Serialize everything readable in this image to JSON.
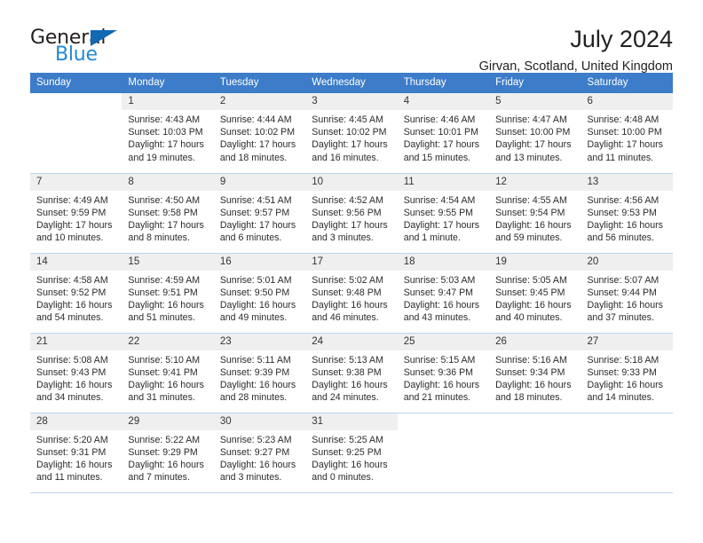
{
  "brand": {
    "name_part1": "General",
    "name_part2": "Blue",
    "triangle_color": "#1268b3",
    "blue_color": "#2389d4"
  },
  "header": {
    "title": "July 2024",
    "subtitle": "Girvan, Scotland, United Kingdom"
  },
  "theme": {
    "header_row_bg": "#3d7cc9",
    "header_row_text": "#ffffff",
    "daynum_bg": "#efefef",
    "cell_border": "#bcd3ec",
    "body_text": "#2b2b2b"
  },
  "calendar": {
    "weekday_headers": [
      "Sunday",
      "Monday",
      "Tuesday",
      "Wednesday",
      "Thursday",
      "Friday",
      "Saturday"
    ],
    "weeks": [
      [
        {
          "day": "",
          "blank": true,
          "lines": []
        },
        {
          "day": "1",
          "lines": [
            "Sunrise: 4:43 AM",
            "Sunset: 10:03 PM",
            "Daylight: 17 hours",
            "and 19 minutes."
          ]
        },
        {
          "day": "2",
          "lines": [
            "Sunrise: 4:44 AM",
            "Sunset: 10:02 PM",
            "Daylight: 17 hours",
            "and 18 minutes."
          ]
        },
        {
          "day": "3",
          "lines": [
            "Sunrise: 4:45 AM",
            "Sunset: 10:02 PM",
            "Daylight: 17 hours",
            "and 16 minutes."
          ]
        },
        {
          "day": "4",
          "lines": [
            "Sunrise: 4:46 AM",
            "Sunset: 10:01 PM",
            "Daylight: 17 hours",
            "and 15 minutes."
          ]
        },
        {
          "day": "5",
          "lines": [
            "Sunrise: 4:47 AM",
            "Sunset: 10:00 PM",
            "Daylight: 17 hours",
            "and 13 minutes."
          ]
        },
        {
          "day": "6",
          "lines": [
            "Sunrise: 4:48 AM",
            "Sunset: 10:00 PM",
            "Daylight: 17 hours",
            "and 11 minutes."
          ]
        }
      ],
      [
        {
          "day": "7",
          "lines": [
            "Sunrise: 4:49 AM",
            "Sunset: 9:59 PM",
            "Daylight: 17 hours",
            "and 10 minutes."
          ]
        },
        {
          "day": "8",
          "lines": [
            "Sunrise: 4:50 AM",
            "Sunset: 9:58 PM",
            "Daylight: 17 hours",
            "and 8 minutes."
          ]
        },
        {
          "day": "9",
          "lines": [
            "Sunrise: 4:51 AM",
            "Sunset: 9:57 PM",
            "Daylight: 17 hours",
            "and 6 minutes."
          ]
        },
        {
          "day": "10",
          "lines": [
            "Sunrise: 4:52 AM",
            "Sunset: 9:56 PM",
            "Daylight: 17 hours",
            "and 3 minutes."
          ]
        },
        {
          "day": "11",
          "lines": [
            "Sunrise: 4:54 AM",
            "Sunset: 9:55 PM",
            "Daylight: 17 hours",
            "and 1 minute."
          ]
        },
        {
          "day": "12",
          "lines": [
            "Sunrise: 4:55 AM",
            "Sunset: 9:54 PM",
            "Daylight: 16 hours",
            "and 59 minutes."
          ]
        },
        {
          "day": "13",
          "lines": [
            "Sunrise: 4:56 AM",
            "Sunset: 9:53 PM",
            "Daylight: 16 hours",
            "and 56 minutes."
          ]
        }
      ],
      [
        {
          "day": "14",
          "lines": [
            "Sunrise: 4:58 AM",
            "Sunset: 9:52 PM",
            "Daylight: 16 hours",
            "and 54 minutes."
          ]
        },
        {
          "day": "15",
          "lines": [
            "Sunrise: 4:59 AM",
            "Sunset: 9:51 PM",
            "Daylight: 16 hours",
            "and 51 minutes."
          ]
        },
        {
          "day": "16",
          "lines": [
            "Sunrise: 5:01 AM",
            "Sunset: 9:50 PM",
            "Daylight: 16 hours",
            "and 49 minutes."
          ]
        },
        {
          "day": "17",
          "lines": [
            "Sunrise: 5:02 AM",
            "Sunset: 9:48 PM",
            "Daylight: 16 hours",
            "and 46 minutes."
          ]
        },
        {
          "day": "18",
          "lines": [
            "Sunrise: 5:03 AM",
            "Sunset: 9:47 PM",
            "Daylight: 16 hours",
            "and 43 minutes."
          ]
        },
        {
          "day": "19",
          "lines": [
            "Sunrise: 5:05 AM",
            "Sunset: 9:45 PM",
            "Daylight: 16 hours",
            "and 40 minutes."
          ]
        },
        {
          "day": "20",
          "lines": [
            "Sunrise: 5:07 AM",
            "Sunset: 9:44 PM",
            "Daylight: 16 hours",
            "and 37 minutes."
          ]
        }
      ],
      [
        {
          "day": "21",
          "lines": [
            "Sunrise: 5:08 AM",
            "Sunset: 9:43 PM",
            "Daylight: 16 hours",
            "and 34 minutes."
          ]
        },
        {
          "day": "22",
          "lines": [
            "Sunrise: 5:10 AM",
            "Sunset: 9:41 PM",
            "Daylight: 16 hours",
            "and 31 minutes."
          ]
        },
        {
          "day": "23",
          "lines": [
            "Sunrise: 5:11 AM",
            "Sunset: 9:39 PM",
            "Daylight: 16 hours",
            "and 28 minutes."
          ]
        },
        {
          "day": "24",
          "lines": [
            "Sunrise: 5:13 AM",
            "Sunset: 9:38 PM",
            "Daylight: 16 hours",
            "and 24 minutes."
          ]
        },
        {
          "day": "25",
          "lines": [
            "Sunrise: 5:15 AM",
            "Sunset: 9:36 PM",
            "Daylight: 16 hours",
            "and 21 minutes."
          ]
        },
        {
          "day": "26",
          "lines": [
            "Sunrise: 5:16 AM",
            "Sunset: 9:34 PM",
            "Daylight: 16 hours",
            "and 18 minutes."
          ]
        },
        {
          "day": "27",
          "lines": [
            "Sunrise: 5:18 AM",
            "Sunset: 9:33 PM",
            "Daylight: 16 hours",
            "and 14 minutes."
          ]
        }
      ],
      [
        {
          "day": "28",
          "lines": [
            "Sunrise: 5:20 AM",
            "Sunset: 9:31 PM",
            "Daylight: 16 hours",
            "and 11 minutes."
          ]
        },
        {
          "day": "29",
          "lines": [
            "Sunrise: 5:22 AM",
            "Sunset: 9:29 PM",
            "Daylight: 16 hours",
            "and 7 minutes."
          ]
        },
        {
          "day": "30",
          "lines": [
            "Sunrise: 5:23 AM",
            "Sunset: 9:27 PM",
            "Daylight: 16 hours",
            "and 3 minutes."
          ]
        },
        {
          "day": "31",
          "lines": [
            "Sunrise: 5:25 AM",
            "Sunset: 9:25 PM",
            "Daylight: 16 hours",
            "and 0 minutes."
          ]
        },
        {
          "day": "",
          "blank": true,
          "lines": []
        },
        {
          "day": "",
          "blank": true,
          "lines": []
        },
        {
          "day": "",
          "blank": true,
          "lines": []
        }
      ]
    ]
  }
}
